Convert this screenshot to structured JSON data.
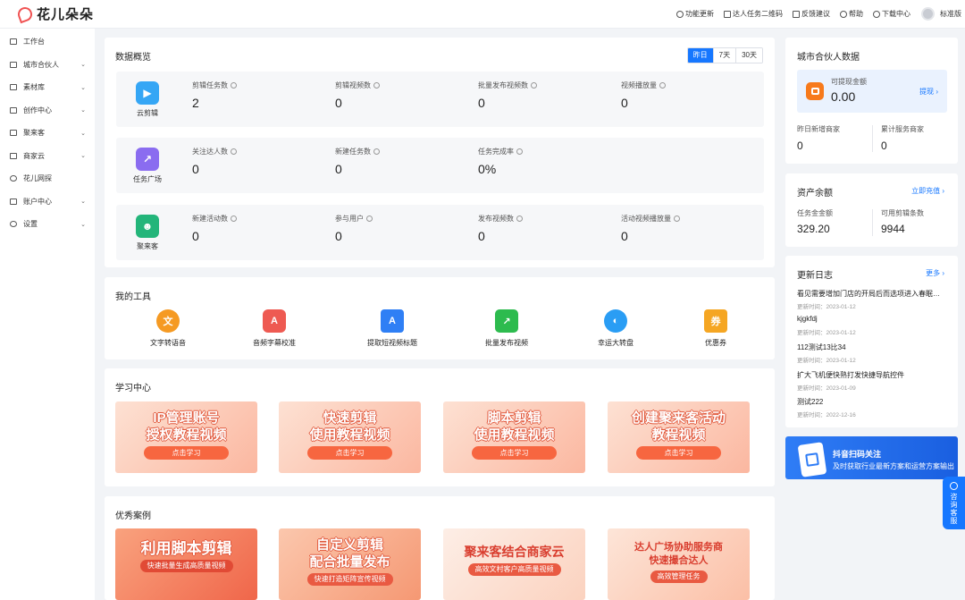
{
  "header": {
    "brand": "花儿朵朵",
    "actions": [
      {
        "label": "功能更新",
        "icon": "clock-icon"
      },
      {
        "label": "达人任务二维码",
        "icon": "qrcode-icon"
      },
      {
        "label": "反馈建议",
        "icon": "feedback-icon"
      },
      {
        "label": "帮助",
        "icon": "help-icon"
      },
      {
        "label": "下载中心",
        "icon": "cloud-download-icon"
      }
    ],
    "version": "标准版"
  },
  "sidebar": {
    "items": [
      {
        "label": "工作台",
        "icon": "dashboard-icon",
        "expandable": false
      },
      {
        "label": "城市合伙人",
        "icon": "partner-icon",
        "expandable": true
      },
      {
        "label": "素材库",
        "icon": "image-icon",
        "expandable": true
      },
      {
        "label": "创作中心",
        "icon": "video-icon",
        "expandable": true
      },
      {
        "label": "聚来客",
        "icon": "grid-icon",
        "expandable": true
      },
      {
        "label": "商家云",
        "icon": "store-icon",
        "expandable": true
      },
      {
        "label": "花儿网探",
        "icon": "user-search-icon",
        "expandable": false
      },
      {
        "label": "账户中心",
        "icon": "account-icon",
        "expandable": true
      },
      {
        "label": "设置",
        "icon": "gear-icon",
        "expandable": true
      }
    ]
  },
  "overview": {
    "title": "数据概览",
    "tabs": [
      {
        "label": "昨日",
        "active": true
      },
      {
        "label": "7天",
        "active": false
      },
      {
        "label": "30天",
        "active": false
      }
    ],
    "rows": [
      {
        "icon_label": "云剪辑",
        "icon": "play-icon",
        "color": "#35a6f5",
        "stats": [
          {
            "label": "剪辑任务数",
            "value": "2"
          },
          {
            "label": "剪辑视频数",
            "value": "0"
          },
          {
            "label": "批量发布视频数",
            "value": "0"
          },
          {
            "label": "视频播放量",
            "value": "0"
          }
        ]
      },
      {
        "icon_label": "任务广场",
        "icon": "task-icon",
        "color": "#8a6cf0",
        "stats": [
          {
            "label": "关注达人数",
            "value": "0"
          },
          {
            "label": "新建任务数",
            "value": "0"
          },
          {
            "label": "任务完成率",
            "value": "0%"
          }
        ]
      },
      {
        "icon_label": "聚来客",
        "icon": "people-icon",
        "color": "#23b57a",
        "stats": [
          {
            "label": "新建活动数",
            "value": "0"
          },
          {
            "label": "参与用户",
            "value": "0"
          },
          {
            "label": "发布视频数",
            "value": "0"
          },
          {
            "label": "活动视频播放量",
            "value": "0"
          }
        ]
      }
    ]
  },
  "tools": {
    "title": "我的工具",
    "items": [
      {
        "label": "文字转语音",
        "icon": "text-to-speech-icon",
        "glyph": "文",
        "color": "#f59a23"
      },
      {
        "label": "音频字幕校准",
        "icon": "microphone-icon",
        "glyph": "A",
        "color": "#ee5a52"
      },
      {
        "label": "提取短视频标题",
        "icon": "clapperboard-icon",
        "glyph": "A",
        "color": "#2f7ff5"
      },
      {
        "label": "批量发布视频",
        "icon": "share-icon",
        "glyph": "↗",
        "color": "#2dbb4e"
      },
      {
        "label": "幸运大转盘",
        "icon": "wheel-icon",
        "glyph": "◐",
        "color": "#2a9df4"
      },
      {
        "label": "优惠券",
        "icon": "coupon-icon",
        "glyph": "券",
        "color": "#f5a623"
      }
    ]
  },
  "learning": {
    "title": "学习中心",
    "items": [
      {
        "line1": "IP管理账号",
        "line2": "授权教程视频",
        "button": "点击学习"
      },
      {
        "line1": "快速剪辑",
        "line2": "使用教程视频",
        "button": "点击学习"
      },
      {
        "line1": "脚本剪辑",
        "line2": "使用教程视频",
        "button": "点击学习"
      },
      {
        "line1": "创建聚来客活动",
        "line2": "教程视频",
        "button": "点击学习"
      }
    ]
  },
  "cases": {
    "title": "优秀案例",
    "items": [
      {
        "line1": "利用脚本剪辑",
        "line2": "",
        "sub": "快速批量生成高质量视频"
      },
      {
        "line1": "自定义剪辑",
        "line2": "配合批量发布",
        "sub": "快速打造矩阵宣传视频"
      },
      {
        "line1": "聚来客结合商家云",
        "line2": "",
        "sub": "高效文村客户高质量视频"
      },
      {
        "line1": "达人广场协助服务商",
        "line2": "快速撮合达人",
        "sub": "高效管理任务"
      }
    ]
  },
  "partner": {
    "title": "城市合伙人数据",
    "withdraw_label": "可提现金额",
    "withdraw_value": "0.00",
    "withdraw_link": "提现 ›",
    "new_merchants_label": "昨日新增商家",
    "new_merchants_value": "0",
    "total_merchants_label": "累计服务商家",
    "total_merchants_value": "0"
  },
  "assets": {
    "title": "资产余额",
    "link": "立即充值 ›",
    "task_label": "任务金金额",
    "task_value": "329.20",
    "clips_label": "可用剪辑条数",
    "clips_value": "9944"
  },
  "changelog": {
    "title": "更新日志",
    "more": "更多 ›",
    "date_prefix": "更新时间：",
    "items": [
      {
        "title": "看见需要增加门店的开局后而选项进入春眠基...",
        "date": "2023-01-12"
      },
      {
        "title": "kjgkfdj",
        "date": "2023-01-12"
      },
      {
        "title": "112测试13比34",
        "date": "2023-01-12"
      },
      {
        "title": "扩大飞机便快熟打发快捷导航控件",
        "date": "2023-01-09"
      },
      {
        "title": "测试222",
        "date": "2022-12-16"
      }
    ]
  },
  "douyin": {
    "title": "抖音扫码关注",
    "subtitle": "及时获取行业最新方案和运营方案输出"
  },
  "float_service": {
    "label": "咨询客服"
  },
  "colors": {
    "primary": "#1677ff",
    "brand": "#f05252",
    "accent_orange": "#f76640"
  }
}
